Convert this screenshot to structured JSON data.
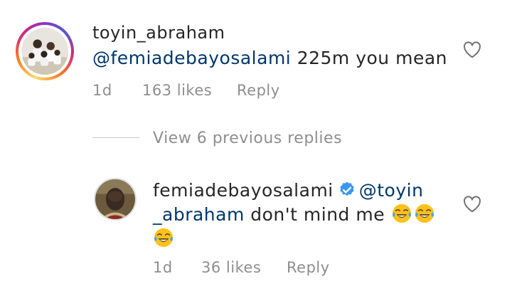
{
  "comments": [
    {
      "username": "toyin_abraham",
      "mention": "@femiadebayosalami",
      "text": " 225m you mean",
      "time": "1d",
      "likes": "163 likes",
      "reply_label": "Reply",
      "verified": false
    },
    {
      "username": "femiadebayosalami",
      "mention_line1": "@toyin",
      "mention_line2": "_abraham",
      "text": " don't mind me",
      "emoji": [
        "face-with-tears-of-joy",
        "face-with-tears-of-joy",
        "face-with-tears-of-joy"
      ],
      "time": "1d",
      "likes": "36 likes",
      "reply_label": "Reply",
      "verified": true
    }
  ],
  "view_replies_label": "View 6 previous replies",
  "colors": {
    "text": "#262626",
    "mention": "#00376b",
    "meta": "#8e8e8e",
    "verified": "#3897f0",
    "divider": "#c7c7c7"
  }
}
